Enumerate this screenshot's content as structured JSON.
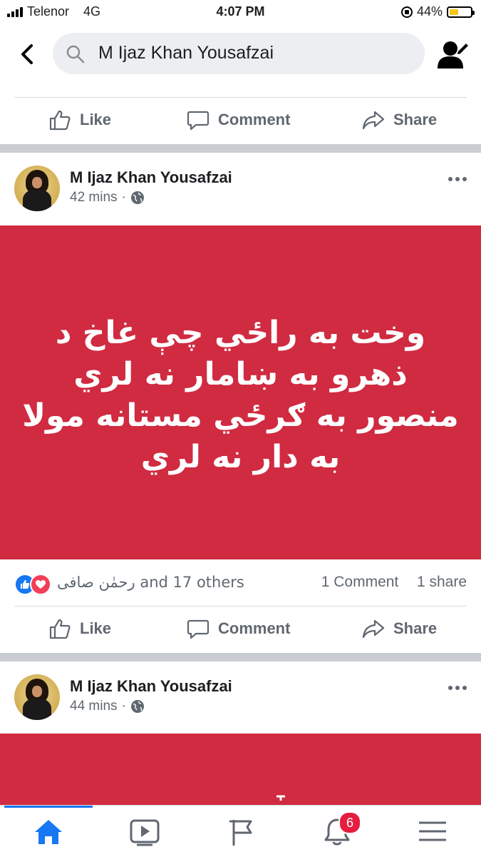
{
  "status_bar": {
    "carrier": "Telenor",
    "network": "4G",
    "time": "4:07 PM",
    "battery": "44%",
    "battery_level": 0.44
  },
  "search": {
    "query": "M Ijaz Khan Yousafzai"
  },
  "actions": {
    "like": "Like",
    "comment": "Comment",
    "share": "Share"
  },
  "posts": [
    {
      "author": "M Ijaz Khan Yousafzai",
      "time": "42 mins",
      "text_lines": [
        "وخت به راځي چې غاخ د",
        "ذهرو به ښامار نه لري",
        "منصور به ګرځي مستانه مولا",
        "به دار نه لري"
      ],
      "background_color": "#d02b41",
      "reactors": "رحمٰن صافی and 17 others",
      "comments": "1 Comment",
      "shares": "1 share"
    },
    {
      "author": "M Ijaz Khan Yousafzai",
      "time": "44 mins",
      "background_color": "#d02b41"
    }
  ],
  "tab_bar": {
    "tabs": [
      "home-icon",
      "watch-icon",
      "pages-icon",
      "notifications-icon",
      "menu-icon"
    ],
    "notification_count": "6",
    "accent": "#1877f2"
  }
}
